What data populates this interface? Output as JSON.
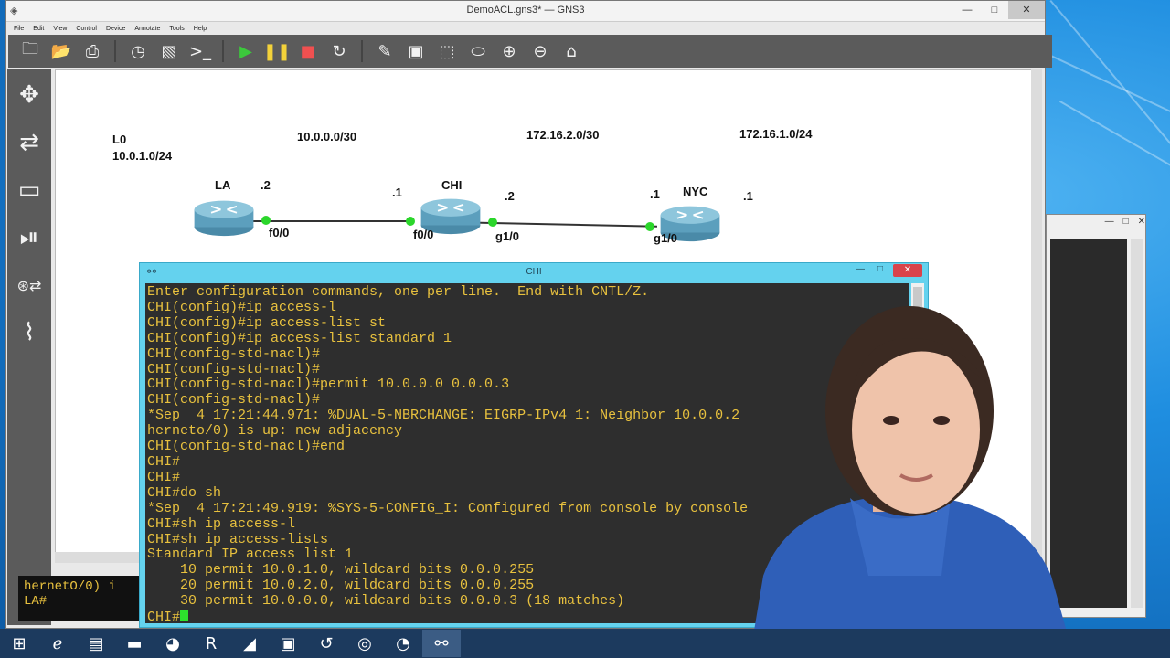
{
  "window": {
    "title": "DemoACL.gns3* — GNS3",
    "min": "—",
    "max": "□",
    "close": "✕"
  },
  "menu": [
    "File",
    "Edit",
    "View",
    "Control",
    "Device",
    "Annotate",
    "Tools",
    "Help"
  ],
  "toolbar_icons": [
    "new-project-icon",
    "open-project-icon",
    "save-project-icon",
    "snapshot-icon",
    "show-interface-labels-icon",
    "console-all-icon",
    "start-all-icon",
    "suspend-all-icon",
    "stop-all-icon",
    "reload-all-icon",
    "add-note-icon",
    "insert-picture-icon",
    "draw-rectangle-icon",
    "draw-ellipse-icon",
    "zoom-in-icon",
    "zoom-out-icon",
    "screenshot-icon"
  ],
  "sidebar_icons": [
    "routers-icon",
    "switches-icon",
    "end-devices-icon",
    "security-devices-icon",
    "all-devices-icon",
    "add-link-icon"
  ],
  "topology": {
    "labels": {
      "l0": "L0",
      "l0_net": "10.0.1.0/24",
      "net1": "10.0.0.0/30",
      "net2": "172.16.2.0/30",
      "net3": "172.16.1.0/24",
      "la_ip": ".2",
      "chi_left_ip": ".1",
      "chi_right_ip": ".2",
      "nyc_left_ip": ".1",
      "nyc_ip": ".1",
      "la_if": "f0/0",
      "chi_if1": "f0/0",
      "chi_if2": "g1/0",
      "nyc_if": "g1/0"
    },
    "routers": [
      "LA",
      "CHI",
      "NYC"
    ]
  },
  "console": {
    "title": "CHI",
    "lines": [
      "Enter configuration commands, one per line.  End with CNTL/Z.",
      "CHI(config)#ip access-l",
      "CHI(config)#ip access-list st",
      "CHI(config)#ip access-list standard 1",
      "CHI(config-std-nacl)#",
      "CHI(config-std-nacl)#",
      "CHI(config-std-nacl)#permit 10.0.0.0 0.0.0.3",
      "CHI(config-std-nacl)#",
      "*Sep  4 17:21:44.971: %DUAL-5-NBRCHANGE: EIGRP-IPv4 1: Neighbor 10.0.0.2",
      "herneto/0) is up: new adjacency",
      "CHI(config-std-nacl)#end",
      "CHI#",
      "CHI#",
      "CHI#do sh",
      "*Sep  4 17:21:49.919: %SYS-5-CONFIG_I: Configured from console by console",
      "CHI#sh ip access-l",
      "CHI#sh ip access-lists",
      "Standard IP access list 1",
      "    10 permit 10.0.1.0, wildcard bits 0.0.0.255",
      "    20 permit 10.0.2.0, wildcard bits 0.0.0.255",
      "    30 permit 10.0.0.0, wildcard bits 0.0.0.3 (18 matches)"
    ],
    "prompt": "CHI#"
  },
  "la_console": {
    "line1": "hernetO/0) i",
    "line2": "LA#"
  },
  "taskbar_icons": [
    "windows-start-icon",
    "internet-explorer-icon",
    "file-explorer-icon",
    "command-prompt-icon",
    "firefox-icon",
    "r-app-icon",
    "wireshark-icon",
    "remote-desktop-icon",
    "folder-sync-icon",
    "gns3-icon",
    "network-icon",
    "putty-icon"
  ],
  "colors": {
    "terminal_text": "#e8c13e",
    "terminal_bg": "#2e2e2e",
    "console_frame": "#64d2ee",
    "link_up": "#2bd62b",
    "toolbar_bg": "#5b5b5b"
  }
}
